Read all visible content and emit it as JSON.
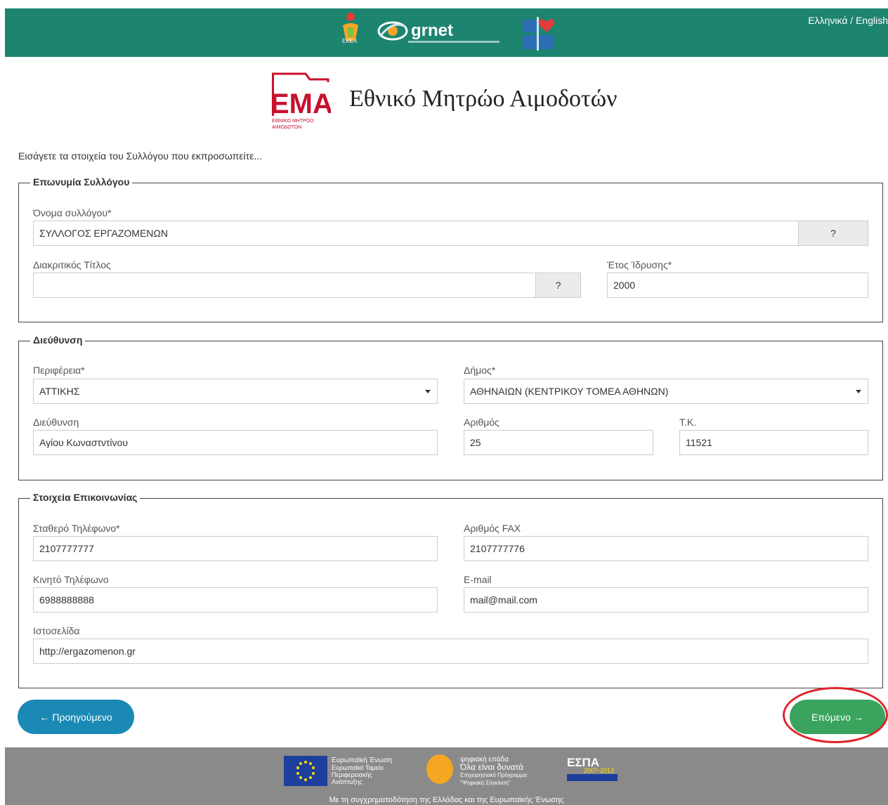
{
  "header": {
    "language_switch": "Ελληνικά / English",
    "partner_grnet": "grnet",
    "partner_ekea": "ΕΚΕΑ"
  },
  "brand": {
    "logo_text": "ΕΜΑ",
    "logo_subtext": "ΕΘΝΙΚΟ ΜΗΤΡΩΟ ΑΙΜΟΔΟΤΩΝ",
    "title": "Εθνικό Μητρώο Αιμοδοτών"
  },
  "intro": "Εισάγετε τα στοιχεία του Συλλόγου που εκπροσωπείτε...",
  "section_name": {
    "legend": "Επωνυμία Συλλόγου",
    "association_name_label": "Όνομα συλλόγου*",
    "association_name_value": "ΣΥΛΛΟΓΟΣ ΕΡΓΑΖΟΜΕΝΩΝ",
    "help_label": "?",
    "distinctive_title_label": "Διακριτικός Τίτλος",
    "distinctive_title_value": "",
    "founding_year_label": "Έτος Ίδρυσης*",
    "founding_year_value": "2000"
  },
  "section_address": {
    "legend": "Διεύθυνση",
    "region_label": "Περιφέρεια*",
    "region_value": "ΑΤΤΙΚΗΣ",
    "municipality_label": "Δήμος*",
    "municipality_value": "ΑΘΗΝΑΙΩΝ (ΚΕΝΤΡΙΚΟΥ ΤΟΜΕΑ ΑΘΗΝΩΝ)",
    "street_label": "Διεύθυνση",
    "street_value": "Αγίου Κωναστντίνου",
    "number_label": "Αριθμός",
    "number_value": "25",
    "postal_label": "Τ.Κ.",
    "postal_value": "11521"
  },
  "section_contact": {
    "legend": "Στοιχεία Επικοινωνίας",
    "landline_label": "Σταθερό Τηλέφωνο*",
    "landline_value": "2107777777",
    "fax_label": "Αριθμός FAX",
    "fax_value": "2107777776",
    "mobile_label": "Κινητό Τηλέφωνο",
    "mobile_value": "6988888888",
    "email_label": "E-mail",
    "email_value": "mail@mail.com",
    "website_label": "Ιστοσελίδα",
    "website_value": "http://ergazomenon.gr"
  },
  "nav": {
    "prev_label": "Προηγούμενο",
    "next_label": "Επόμενο"
  },
  "footer": {
    "eu_lines": [
      "Ευρωπαϊκή Ένωση",
      "Ευρωπαϊκό Ταμείο",
      "Περιφερειακής",
      "Ανάπτυξης"
    ],
    "dg_lines": [
      "ψηφιακή επάδα",
      "Όλα είναι δυνατά",
      "Επιχειρησιακό Πρόγραμμα",
      "\"Ψηφιακή Σύγκλιση\""
    ],
    "espa_label": "ΕΣΠΑ",
    "espa_years": "2007-2013",
    "funding_text": "Με τη συγχρηματοδότηση της Ελλάδας και της Ευρωπαϊκής Ένωσης"
  },
  "colors": {
    "header_bg": "#1d8470",
    "prev_button": "#1a8ab5",
    "next_button": "#3aa45e",
    "highlight_ring": "#e0242a",
    "footer_bg": "#8a8a8a"
  }
}
